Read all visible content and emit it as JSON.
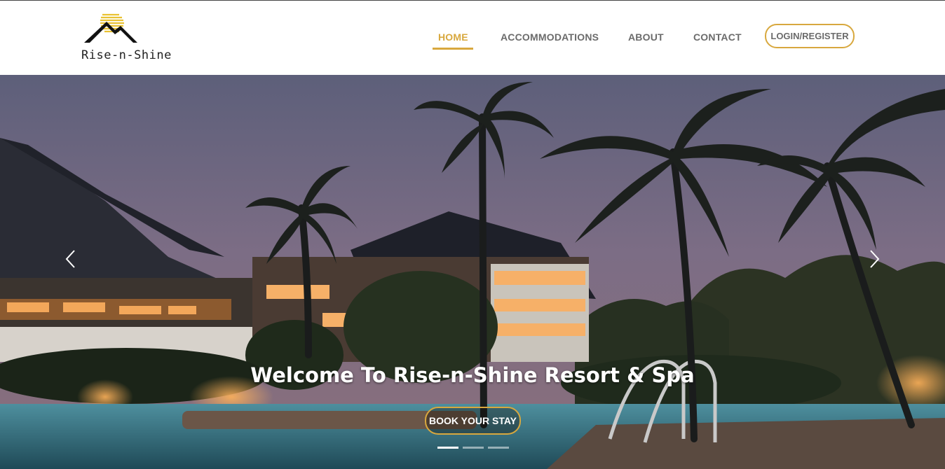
{
  "brand": {
    "name": "Rise-n-Shine"
  },
  "nav": {
    "items": [
      {
        "label": "HOME"
      },
      {
        "label": "ACCOMMODATIONS"
      },
      {
        "label": "ABOUT"
      },
      {
        "label": "CONTACT"
      }
    ],
    "login_label": "LOGIN/REGISTER"
  },
  "hero": {
    "headline": "Welcome To Rise-n-Shine Resort & Spa",
    "cta_label": "BOOK YOUR STAY",
    "slide_count": 3,
    "active_slide": 1
  },
  "colors": {
    "accent": "#d8a83e",
    "nav_text": "#6b6b6b",
    "hero_text": "#ffffff"
  },
  "icons": {
    "prev": "chevron-left-icon",
    "next": "chevron-right-icon",
    "logo": "mountain-sun-logo-icon"
  }
}
